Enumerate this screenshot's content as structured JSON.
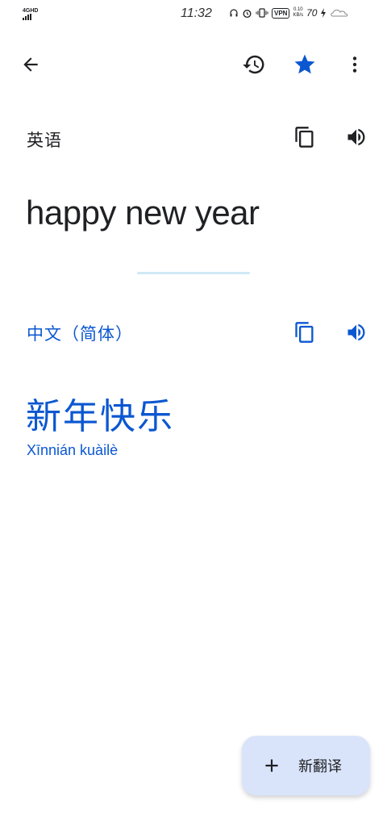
{
  "status_bar": {
    "network": "4GHD",
    "time": "11:32",
    "vpn": "VPN",
    "speed_value": "0.10",
    "speed_unit": "KB/s",
    "battery": "70"
  },
  "toolbar": {
    "back_icon": "arrow-back-icon",
    "history_icon": "history-icon",
    "star_icon": "star-icon",
    "more_icon": "more-vert-icon",
    "star_color": "#0b57d0"
  },
  "source": {
    "language": "英语",
    "text": "happy new year"
  },
  "target": {
    "language": "中文（简体）",
    "text": "新年快乐",
    "romanization": "Xīnnián kuàilè",
    "accent": "#0b57d0"
  },
  "fab": {
    "label": "新翻译",
    "icon": "plus-icon"
  }
}
